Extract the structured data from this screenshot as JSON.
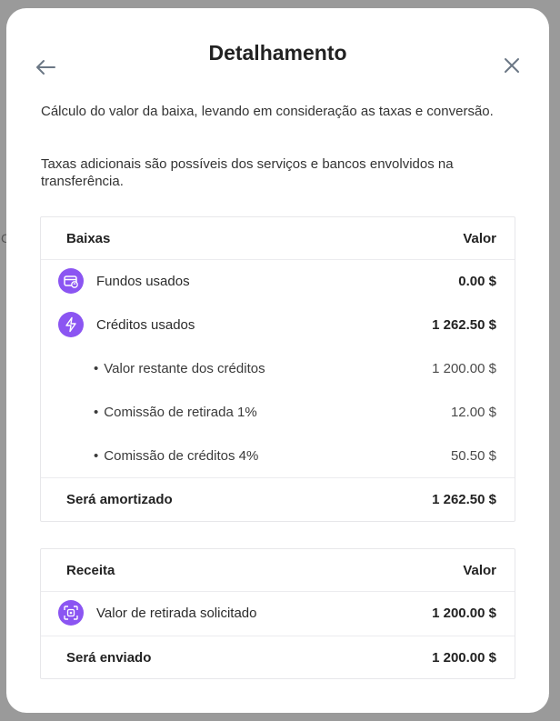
{
  "modal": {
    "title": "Detalhamento",
    "description_1": "Cálculo do valor da baixa, levando em consideração as taxas e conversão.",
    "description_2": "Taxas adicionais são possíveis dos serviços e bancos envolvidos na transferência."
  },
  "baixas_table": {
    "header_label": "Baixas",
    "header_value": "Valor",
    "rows": [
      {
        "label": "Fundos usados",
        "value": "0.00 $",
        "icon": "wallet-refresh-icon"
      },
      {
        "label": "Créditos usados",
        "value": "1 262.50 $",
        "icon": "lightning-icon"
      }
    ],
    "sub_rows": [
      {
        "label": "Valor restante dos créditos",
        "value": "1 200.00 $"
      },
      {
        "label": "Comissão de retirada 1%",
        "value": "12.00 $"
      },
      {
        "label": "Comissão de créditos 4%",
        "value": "50.50 $"
      }
    ],
    "total_label": "Será amortizado",
    "total_value": "1 262.50 $"
  },
  "receita_table": {
    "header_label": "Receita",
    "header_value": "Valor",
    "rows": [
      {
        "label": "Valor de retirada solicitado",
        "value": "1 200.00 $",
        "icon": "scan-withdraw-icon"
      }
    ],
    "total_label": "Será enviado",
    "total_value": "1 200.00 $"
  },
  "colors": {
    "accent": "#8b55f2",
    "overlay": "#9a9a9a"
  }
}
